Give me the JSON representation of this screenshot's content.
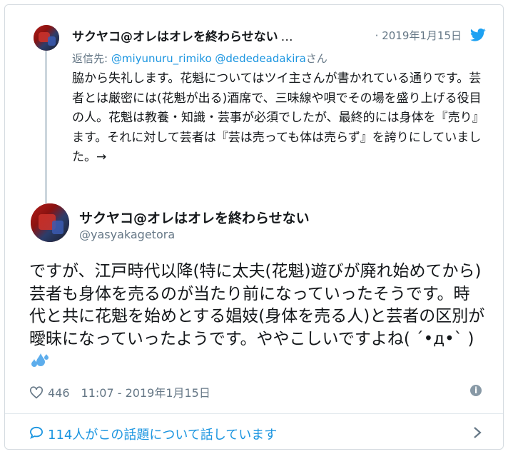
{
  "parent_tweet": {
    "author_name": "サクヤコ@オレはオレを終わらせない",
    "ellipsis": "…",
    "date": "· 2019年1月15日",
    "reply_prefix": "返信先: ",
    "reply_mentions": "@miyunuru_rimiko @dededeadakira",
    "reply_suffix": "さん",
    "text": "脇から失礼します。花魁についてはツイ主さんが書かれている通りです。芸者とは厳密には(花魁が出る)酒席で、三味線や唄でその場を盛り上げる役目の人。花魁は教養・知識・芸事が必須でしたが、最終的には身体を『売り』ます。それに対して芸者は『芸は売っても体は売らず』を誇りにしていました。→"
  },
  "main_tweet": {
    "author_name": "サクヤコ@オレはオレを終わらせない",
    "handle": "@yasyakagetora",
    "text": "ですが、江戸時代以降(特に太夫(花魁)遊びが廃れ始めてから)芸者も身体を売るのが当たり前になっていったそうです。時代と共に花魁を始めとする娼妓(身体を売る人)と芸者の区別が曖昧になっていったようです。ややこしいですよね( ´•д•` )",
    "likes": "446",
    "timestamp": "11:07 - 2019年1月15日"
  },
  "footer": {
    "conversation_text": "114人がこの話題について話しています"
  },
  "icons": {
    "bird": "twitter-bird-icon",
    "heart": "heart-icon",
    "info": "info-icon",
    "bubble": "speech-bubble-icon",
    "chevron": "chevron-right-icon",
    "sweat": "sweat-droplets-emoji"
  },
  "colors": {
    "link_blue": "#1b95e0",
    "muted_gray": "#657786",
    "text": "#14171a",
    "border": "#d5dbe0"
  }
}
